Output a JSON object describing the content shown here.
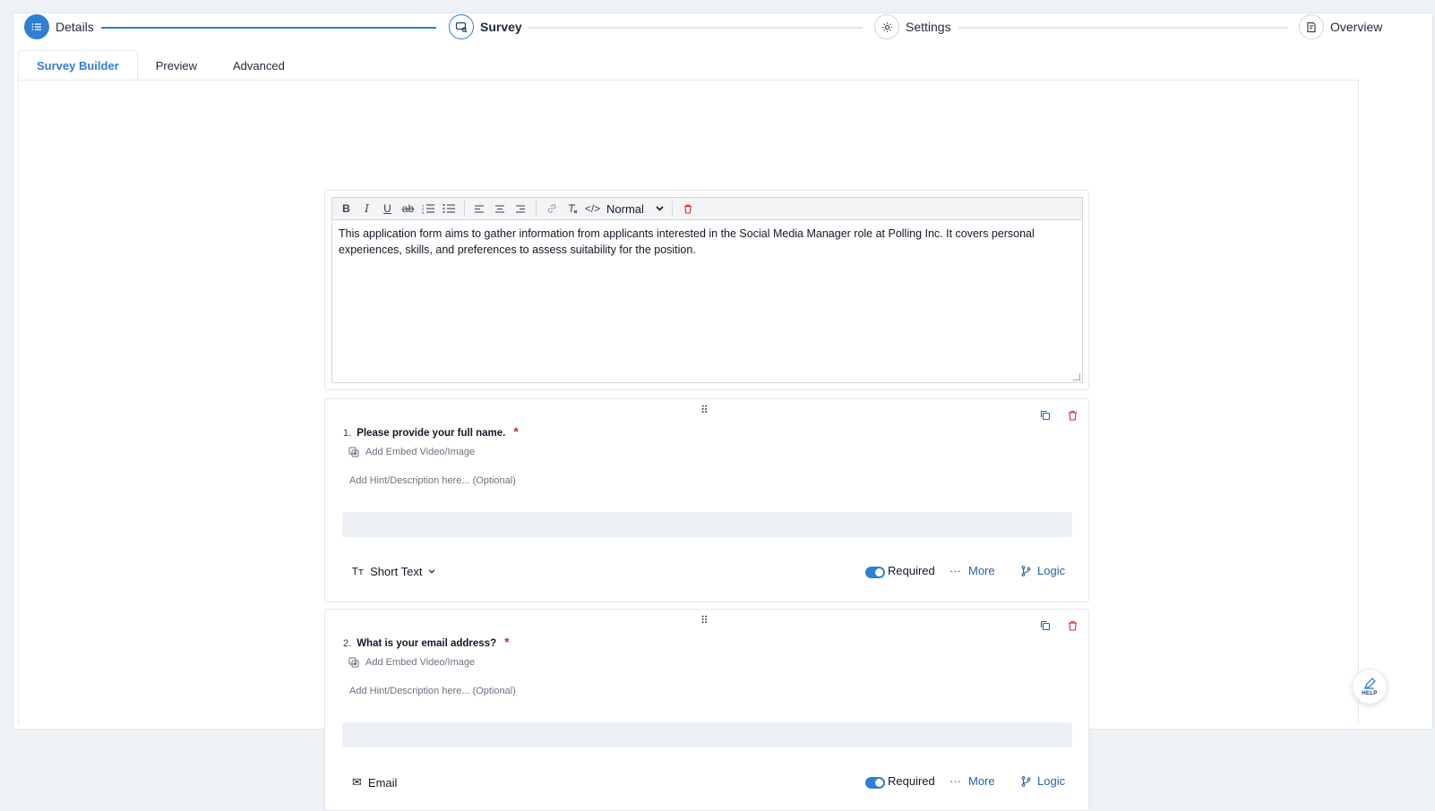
{
  "stepper": {
    "steps": [
      {
        "label": "Details",
        "icon": "list-icon"
      },
      {
        "label": "Survey",
        "icon": "survey-search-icon"
      },
      {
        "label": "Settings",
        "icon": "gear-icon"
      },
      {
        "label": "Overview",
        "icon": "document-icon"
      }
    ]
  },
  "tabs": [
    {
      "label": "Survey Builder"
    },
    {
      "label": "Preview"
    },
    {
      "label": "Advanced"
    }
  ],
  "editor": {
    "toolbar": {
      "bold": "B",
      "italic": "I",
      "underline": "U",
      "strike": "ab",
      "code": "</>",
      "format_value": "Normal"
    },
    "text": "This application form aims to gather information from applicants interested in the Social Media Manager role at Polling Inc. It covers personal experiences, skills, and preferences to assess suitability for the position."
  },
  "questions": [
    {
      "number": "1.",
      "title": "Please provide your full name.",
      "required_mark": "*",
      "embed_label": "Add Embed Video/Image",
      "hint_placeholder": "Add Hint/Description here... (Optional)",
      "type": "Short Text",
      "required_label": "Required",
      "more_label": "More",
      "logic_label": "Logic"
    },
    {
      "number": "2.",
      "title": "What is your email address?",
      "required_mark": "*",
      "embed_label": "Add Embed Video/Image",
      "hint_placeholder": "Add Hint/Description here... (Optional)",
      "type": "Email",
      "required_label": "Required",
      "more_label": "More",
      "logic_label": "Logic"
    }
  ],
  "help": {
    "label": "HELP"
  },
  "colors": {
    "accent": "#2e7ed5",
    "danger": "#dc2626",
    "link": "#2563a8"
  }
}
